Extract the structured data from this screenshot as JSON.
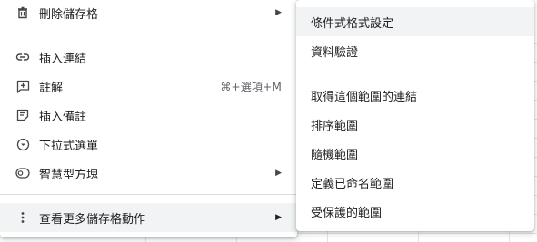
{
  "main_menu": {
    "items": [
      {
        "label": "刪除儲存格",
        "icon": "trash-icon",
        "has_submenu": true
      },
      {
        "label": "插入連結",
        "icon": "link-icon"
      },
      {
        "label": "註解",
        "icon": "comment-add-icon",
        "shortcut": "⌘+選項+M"
      },
      {
        "label": "插入備註",
        "icon": "note-icon"
      },
      {
        "label": "下拉式選單",
        "icon": "dropdown-circle-icon"
      },
      {
        "label": "智慧型方塊",
        "icon": "smart-chip-icon",
        "has_submenu": true
      },
      {
        "label": "查看更多儲存格動作",
        "icon": "more-vert-icon",
        "has_submenu": true
      }
    ],
    "submenu_arrow": "▶"
  },
  "sub_menu": {
    "items": [
      {
        "label": "條件式格式設定"
      },
      {
        "label": "資料驗證"
      },
      {
        "label": "取得這個範圍的連結"
      },
      {
        "label": "排序範圍"
      },
      {
        "label": "隨機範圍"
      },
      {
        "label": "定義已命名範圍"
      },
      {
        "label": "受保護的範圍"
      }
    ]
  }
}
